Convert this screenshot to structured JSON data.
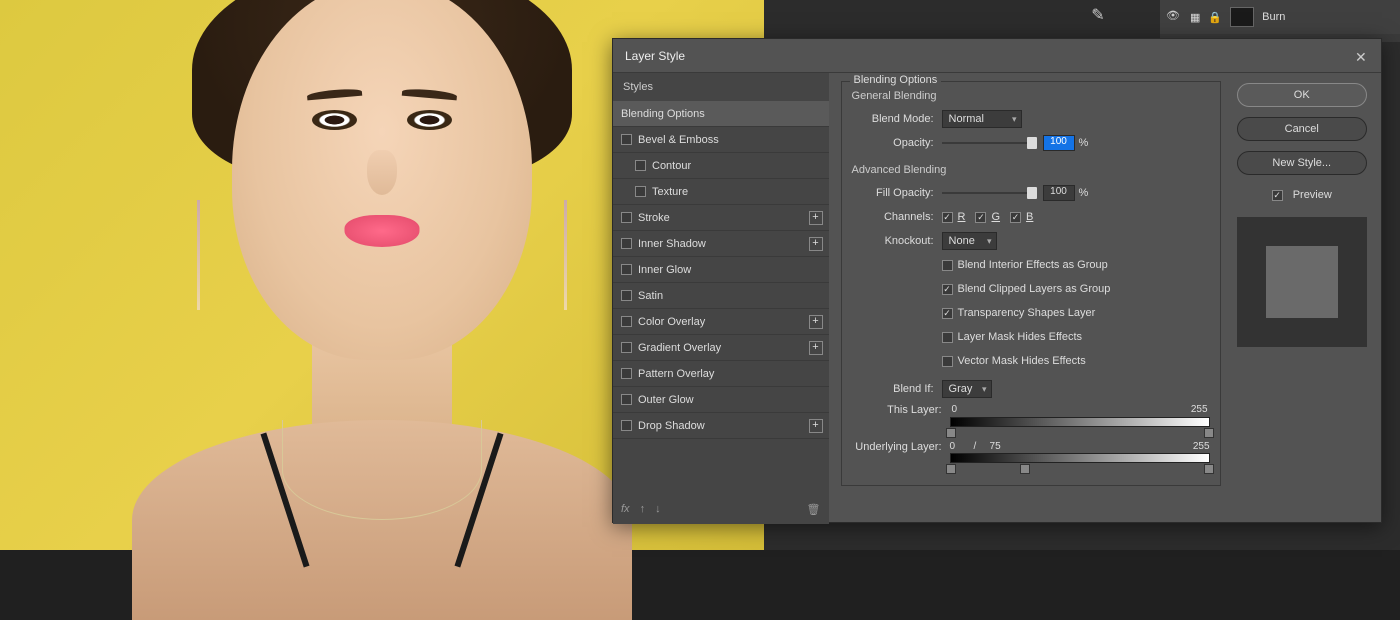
{
  "layers": {
    "row": {
      "name": "Burn"
    }
  },
  "dialog": {
    "title": "Layer Style",
    "styles_header": "Styles",
    "items": {
      "blending_options": "Blending Options",
      "bevel_emboss": "Bevel & Emboss",
      "contour": "Contour",
      "texture": "Texture",
      "stroke": "Stroke",
      "inner_shadow": "Inner Shadow",
      "inner_glow": "Inner Glow",
      "satin": "Satin",
      "color_overlay": "Color Overlay",
      "gradient_overlay": "Gradient Overlay",
      "pattern_overlay": "Pattern Overlay",
      "outer_glow": "Outer Glow",
      "drop_shadow": "Drop Shadow"
    },
    "footer": {
      "fx": "fx"
    }
  },
  "opts": {
    "section_title": "Blending Options",
    "general_title": "General Blending",
    "blend_mode_label": "Blend Mode:",
    "blend_mode_value": "Normal",
    "opacity_label": "Opacity:",
    "opacity_value": "100",
    "pct": "%",
    "advanced_title": "Advanced Blending",
    "fill_opacity_label": "Fill Opacity:",
    "fill_opacity_value": "100",
    "channels_label": "Channels:",
    "chan_r": "R",
    "chan_g": "G",
    "chan_b": "B",
    "knockout_label": "Knockout:",
    "knockout_value": "None",
    "chk_interior": "Blend Interior Effects as Group",
    "chk_clipped": "Blend Clipped Layers as Group",
    "chk_transparency": "Transparency Shapes Layer",
    "chk_layermask": "Layer Mask Hides Effects",
    "chk_vectormask": "Vector Mask Hides Effects",
    "blendif_label": "Blend If:",
    "blendif_value": "Gray",
    "this_layer_label": "This Layer:",
    "this_layer_lo": "0",
    "this_layer_hi": "255",
    "underlying_label": "Underlying Layer:",
    "underlying_lo": "0",
    "underlying_mid": "75",
    "underlying_hi": "255",
    "slash": "/"
  },
  "buttons": {
    "ok": "OK",
    "cancel": "Cancel",
    "new_style": "New Style...",
    "preview": "Preview"
  }
}
